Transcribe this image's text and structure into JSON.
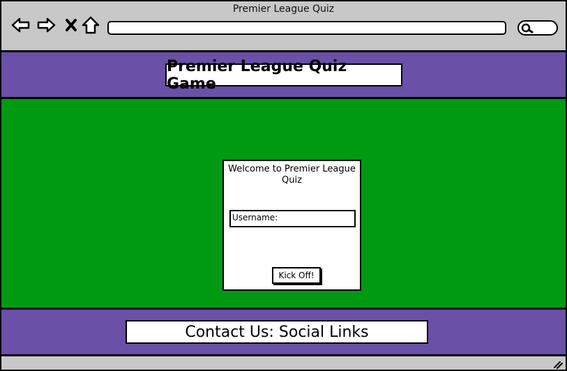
{
  "window": {
    "title": "Premier League Quiz"
  },
  "toolbar": {
    "icons": [
      "back-arrow-icon",
      "forward-arrow-icon",
      "close-icon",
      "home-icon",
      "search-icon"
    ],
    "url_value": "",
    "search_value": ""
  },
  "header": {
    "title": "Premier League Quiz Game"
  },
  "quiz": {
    "welcome": "Welcome to Premier League Quiz",
    "username_label": "Username:",
    "kickoff_label": "Kick Off!"
  },
  "footer": {
    "contact": "Contact Us: Social Links"
  },
  "colors": {
    "band": "#6a50a7",
    "pitch": "#009a12",
    "chrome": "#c8c8c8"
  }
}
